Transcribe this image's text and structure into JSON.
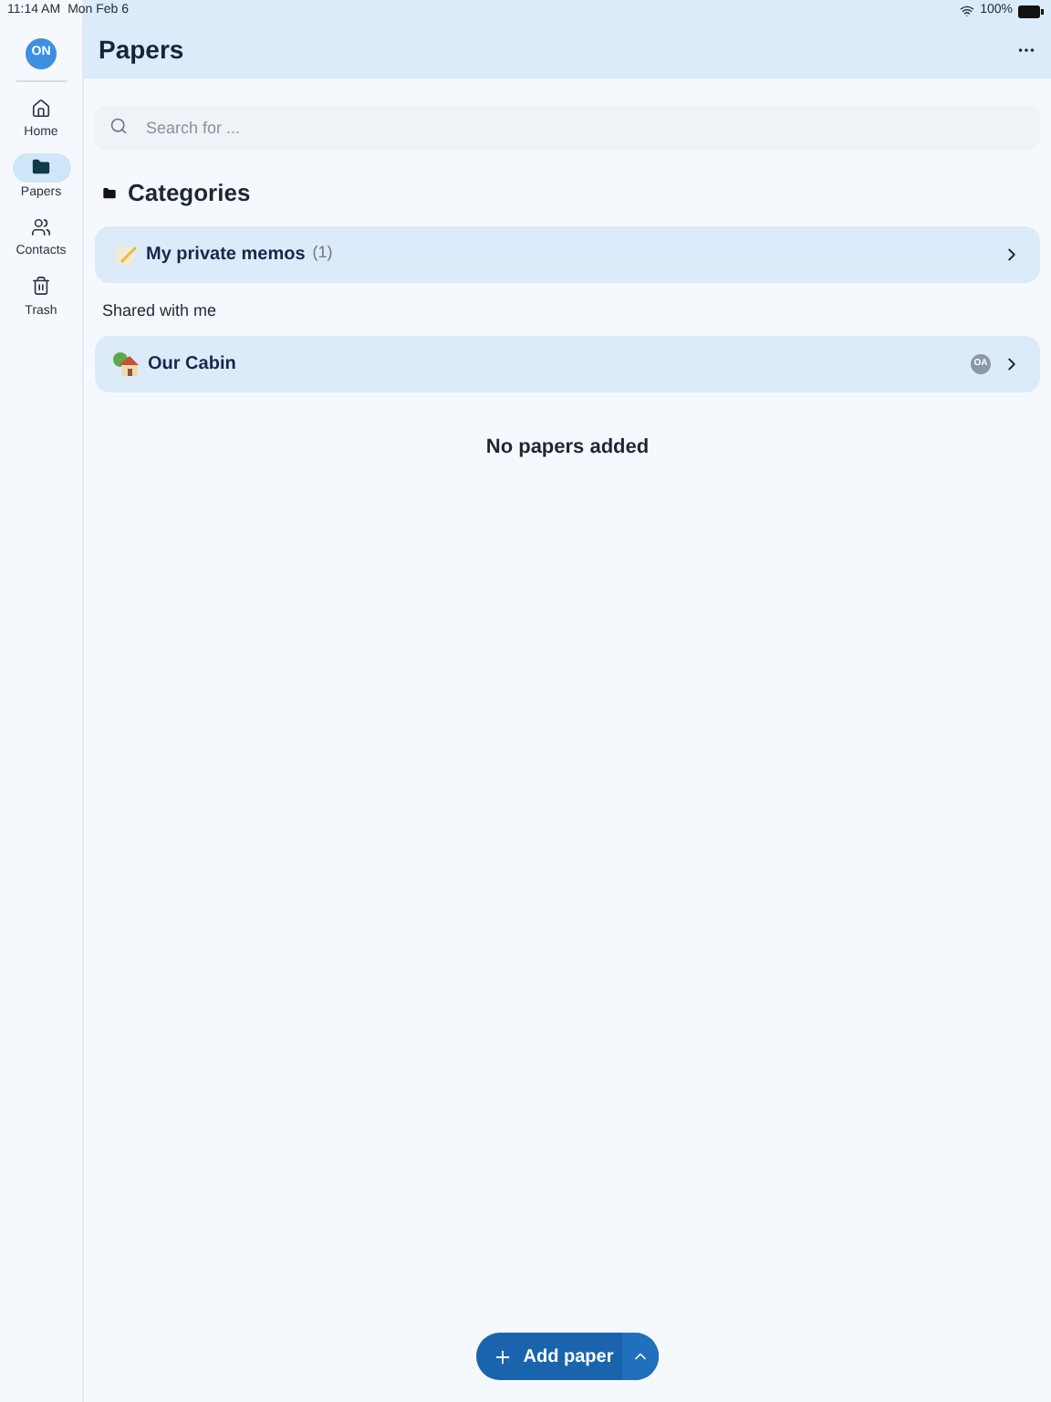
{
  "status_bar": {
    "time": "11:14 AM",
    "date": "Mon Feb 6",
    "battery": "100%"
  },
  "sidebar": {
    "avatar": "ON",
    "items": [
      {
        "label": "Home",
        "selected": false
      },
      {
        "label": "Papers",
        "selected": true
      },
      {
        "label": "Contacts",
        "selected": false
      },
      {
        "label": "Trash",
        "selected": false
      }
    ]
  },
  "header": {
    "title": "Papers"
  },
  "search": {
    "placeholder": "Search for ..."
  },
  "categories": {
    "title": "Categories",
    "items": [
      {
        "name": "My private memos",
        "count": "(1)"
      }
    ]
  },
  "shared": {
    "title": "Shared with me",
    "items": [
      {
        "name": "Our Cabin",
        "owner": "OA"
      }
    ]
  },
  "empty_message": "No papers added",
  "add_button": {
    "label": "Add paper"
  }
}
